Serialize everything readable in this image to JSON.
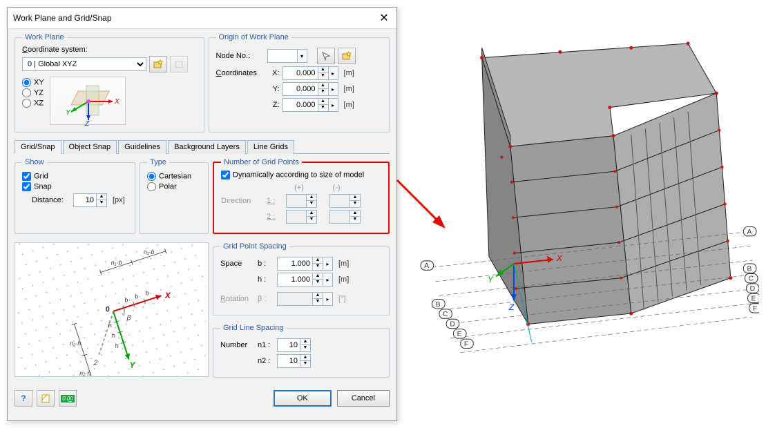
{
  "dialog": {
    "title": "Work Plane and Grid/Snap",
    "workPlane": {
      "legend": "Work Plane",
      "coordLabel": "Coordinate system:",
      "coordValue": "0 | Global XYZ",
      "planes": {
        "xy": "XY",
        "yz": "YZ",
        "xz": "XZ"
      }
    },
    "origin": {
      "legend": "Origin of Work Plane",
      "nodeLabel": "Node No.:",
      "coordsLabel": "Coordinates",
      "x": {
        "label": "X:",
        "value": "0.000",
        "unit": "[m]"
      },
      "y": {
        "label": "Y:",
        "value": "0.000",
        "unit": "[m]"
      },
      "z": {
        "label": "Z:",
        "value": "0.000",
        "unit": "[m]"
      }
    },
    "tabs": {
      "gridsnap": "Grid/Snap",
      "objectsnap": "Object Snap",
      "guidelines": "Guidelines",
      "bglayers": "Background Layers",
      "linegrids": "Line Grids"
    },
    "show": {
      "legend": "Show",
      "grid": "Grid",
      "snap": "Snap",
      "distanceLabel": "Distance:",
      "distanceValue": "10",
      "distanceUnit": "[px]"
    },
    "type": {
      "legend": "Type",
      "cartesian": "Cartesian",
      "polar": "Polar"
    },
    "gridPoints": {
      "legend": "Number of Grid Points",
      "dynamic": "Dynamically according to size of model",
      "plus": "(+)",
      "minus": "(-)",
      "direction": "Direction",
      "one": "1 :",
      "two": "2 :"
    },
    "spacing": {
      "legend": "Grid Point Spacing",
      "space": "Space",
      "b": "b :",
      "bVal": "1.000",
      "h": "h :",
      "hVal": "1.000",
      "rotation": "Rotation",
      "beta": "β :",
      "unit": "[m]",
      "degUnit": "[°]"
    },
    "lineSpacing": {
      "legend": "Grid Line Spacing",
      "number": "Number",
      "n1": "n1 :",
      "n1Val": "10",
      "n2": "n2 :",
      "n2Val": "10"
    },
    "footer": {
      "ok": "OK",
      "cancel": "Cancel"
    }
  }
}
